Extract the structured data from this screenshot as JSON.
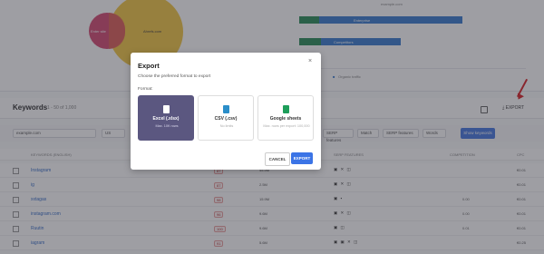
{
  "background": {
    "venn": {
      "left_label": "Enter site",
      "right_label": "Ahrefs.com",
      "top_text": "example.com"
    },
    "bars": [
      {
        "text": "Enterprise",
        "colors": [
          "#2f8f5b",
          "#3d7fd0"
        ]
      },
      {
        "text": "Competitors",
        "colors": [
          "#2f8f5b",
          "#3d7fd0"
        ]
      }
    ],
    "legend": "Organic traffic",
    "legend_prefix": "■"
  },
  "keywords_section": {
    "title": "Keywords",
    "subtitle": "1 - 50 of 1,000",
    "export_label": "EXPORT",
    "filters": [
      "example.com",
      "US",
      "SERP features",
      "Match",
      "SERP features",
      "Words"
    ],
    "action_button": "Show keywords",
    "columns": [
      "Keywords (English)",
      "Vol",
      "Volume",
      "SERP features",
      "Competition",
      "CPC"
    ],
    "rows": [
      {
        "keyword": "Instagram",
        "badge": "87",
        "volume": "45.5M",
        "serp": "▣ ✕ ◫",
        "competition": "",
        "cpc": "€0.01"
      },
      {
        "keyword": "ig",
        "badge": "87",
        "volume": "2.5M",
        "serp": "▣ ✕ ◫",
        "competition": "",
        "cpc": "€0.01"
      },
      {
        "keyword": "xxtagas",
        "badge": "98",
        "volume": "15.9M",
        "serp": "▣ ▪",
        "competition": "0.00",
        "cpc": "€0.01"
      },
      {
        "keyword": "instagram.com",
        "badge": "96",
        "volume": "9.6M",
        "serp": "▣ ✕ ◫",
        "competition": "0.00",
        "cpc": "€0.01"
      },
      {
        "keyword": "Ruutin",
        "badge": "100",
        "volume": "9.6M",
        "serp": "▣ ◫",
        "competition": "0.01",
        "cpc": "€0.01"
      },
      {
        "keyword": "iagram",
        "badge": "91",
        "volume": "5.6M",
        "serp": "▣ ▣ ✕ ◫",
        "competition": "",
        "cpc": "€0.25"
      }
    ]
  },
  "modal": {
    "title": "Export",
    "close": "×",
    "description": "Choose the preferred format to export",
    "format_label": "Format:",
    "options": [
      {
        "name": "Excel (.xlsx)",
        "note": "Max. 10K rows",
        "selected": true,
        "icon_color": "#ffffff"
      },
      {
        "name": "CSV (.csv)",
        "note": "No limits",
        "selected": false,
        "icon_color": "#2b8ec9"
      },
      {
        "name": "Google sheets",
        "note": "Max. rows per export: 100,000",
        "selected": false,
        "icon_color": "#1e9e5a"
      }
    ],
    "cancel_label": "CANCEL",
    "export_label": "EXPORT"
  }
}
